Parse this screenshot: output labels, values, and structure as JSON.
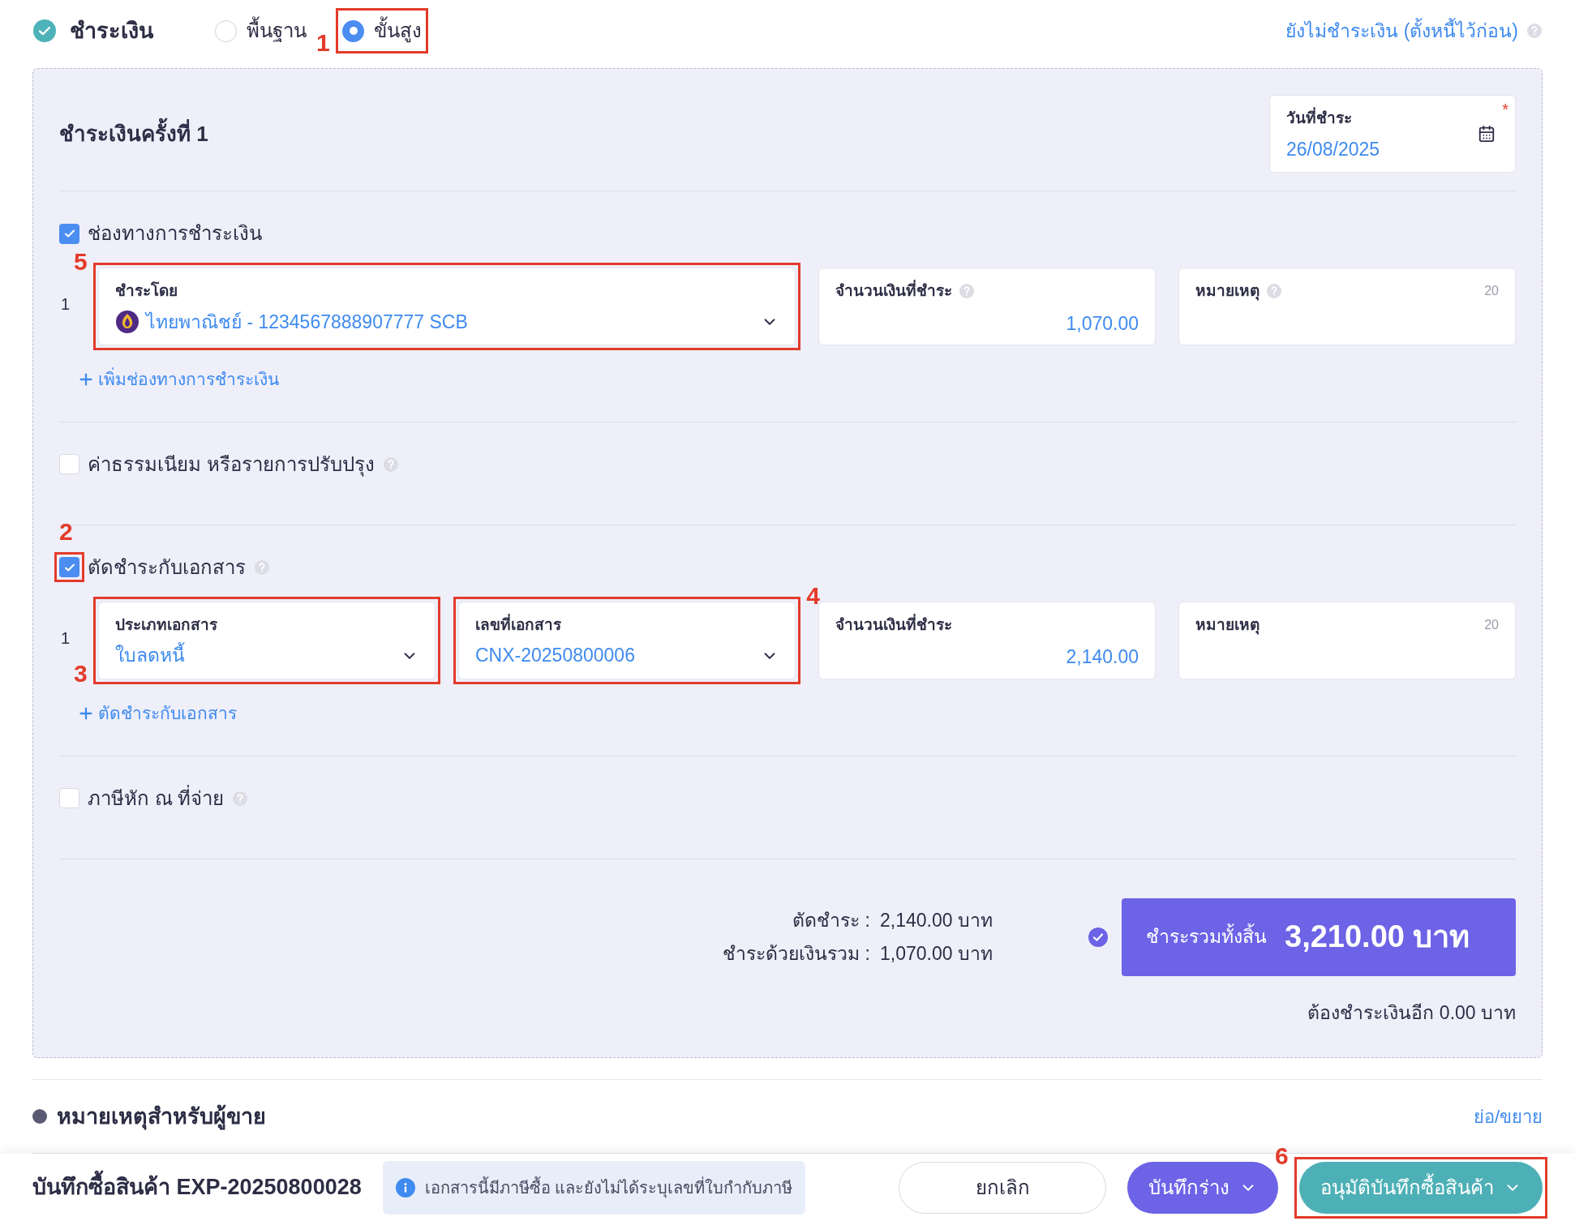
{
  "payment": {
    "title": "ชำระเงิน",
    "modes": [
      {
        "label": "พื้นฐาน",
        "selected": false
      },
      {
        "label": "ขั้นสูง",
        "selected": true,
        "annotation": {
          "label": "1"
        }
      }
    ],
    "defer_link": "ยังไม่ชำระเงิน (ตั้งหนี้ไว้ก่อน)"
  },
  "installment": {
    "title": "ชำระเงินครั้งที่ 1",
    "date": {
      "label": "วันที่ชำระ",
      "value": "26/08/2025",
      "required_mark": "*"
    }
  },
  "sections": [
    {
      "label": "ช่องทางการชำระเงิน",
      "checked": true,
      "help": false,
      "rows": [
        {
          "index": "1",
          "fields": [
            {
              "kind": "bank-select",
              "label": "ชำระโดย",
              "help": false,
              "value": "ไทยพาณิชย์ - 1234567888907777 SCB",
              "annotation": {
                "label": "5"
              }
            },
            {
              "kind": "amount",
              "label": "จำนวนเงินที่ชำระ",
              "help": true,
              "value": "1,070.00"
            },
            {
              "kind": "note",
              "label": "หมายเหตุ",
              "help": true,
              "counter": "20"
            }
          ]
        }
      ],
      "add_link": "เพิ่มช่องทางการชำระเงิน"
    },
    {
      "label": "ค่าธรรมเนียม หรือรายการปรับปรุง",
      "checked": false,
      "help": true
    },
    {
      "label": "ตัดชำระกับเอกสาร",
      "checked": true,
      "help": true,
      "annotation": {
        "label": "2"
      },
      "rows": [
        {
          "index": "1",
          "fields": [
            {
              "kind": "select",
              "label": "ประเภทเอกสาร",
              "help": false,
              "value": "ใบลดหนี้",
              "annotation": {
                "label": "3"
              }
            },
            {
              "kind": "select",
              "label": "เลขที่เอกสาร",
              "help": false,
              "value": "CNX-20250800006",
              "annotation": {
                "label": "4"
              }
            },
            {
              "kind": "amount",
              "label": "จำนวนเงินที่ชำระ",
              "help": false,
              "value": "2,140.00"
            },
            {
              "kind": "note",
              "label": "หมายเหตุ",
              "help": false,
              "counter": "20"
            }
          ]
        }
      ],
      "add_link": "ตัดชำระกับเอกสาร"
    },
    {
      "label": "ภาษีหัก ณ ที่จ่าย",
      "checked": false,
      "help": true
    }
  ],
  "summary": {
    "lines": [
      {
        "label": "ตัดชำระ :",
        "value": "2,140.00 บาท"
      },
      {
        "label": "ชำระด้วยเงินรวม :",
        "value": "1,070.00 บาท"
      }
    ],
    "verified": true,
    "total_label": "ชำระรวมทั้งสิ้น",
    "total_value": "3,210.00 บาท",
    "remaining": "ต้องชำระเงินอีก 0.00 บาท"
  },
  "seller_note": {
    "title": "หมายเหตุสำหรับผู้ขาย",
    "toggle": "ย่อ/ขยาย"
  },
  "footer": {
    "title": "บันทึกซื้อสินค้า EXP-20250800028",
    "notice": "เอกสารนี้มีภาษีซื้อ และยังไม่ได้ระบุเลขที่ใบกำกับภาษี",
    "buttons": [
      {
        "kind": "outline",
        "label": "ยกเลิก",
        "dropdown": false
      },
      {
        "kind": "primary",
        "label": "บันทึกร่าง",
        "dropdown": true
      },
      {
        "kind": "approve",
        "label": "อนุมัติบันทึกซื้อสินค้า",
        "dropdown": true,
        "annotation": {
          "label": "6"
        }
      }
    ]
  }
}
